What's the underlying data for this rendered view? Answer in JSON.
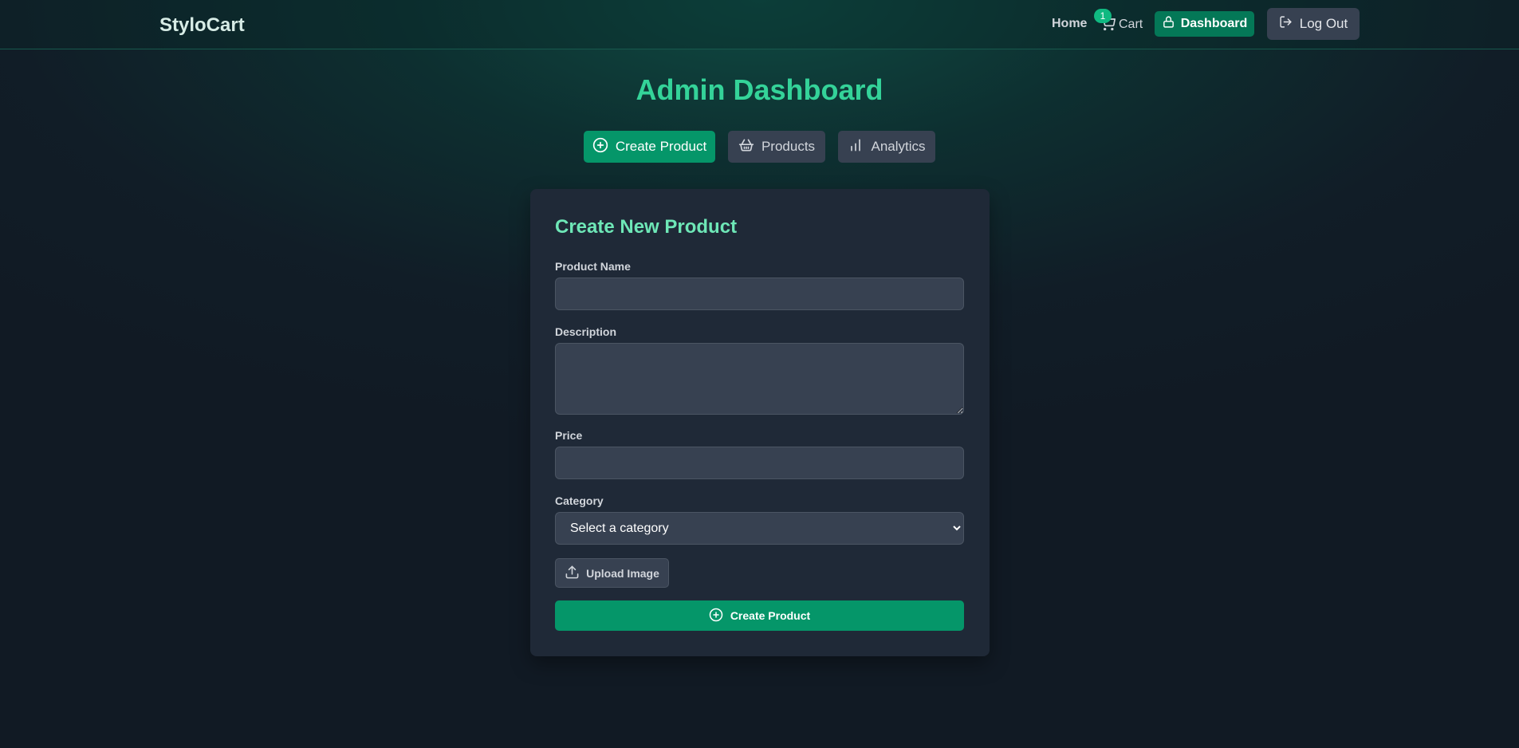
{
  "nav": {
    "brand": "StyloCart",
    "home": "Home",
    "cart": "Cart",
    "cart_count": "1",
    "dashboard": "Dashboard",
    "logout": "Log Out"
  },
  "page": {
    "title": "Admin Dashboard"
  },
  "tabs": [
    {
      "label": "Create Product",
      "icon": "plus-circle-icon",
      "active": true
    },
    {
      "label": "Products",
      "icon": "basket-icon",
      "active": false
    },
    {
      "label": "Analytics",
      "icon": "bar-chart-icon",
      "active": false
    }
  ],
  "form": {
    "title": "Create New Product",
    "name_label": "Product Name",
    "name_value": "",
    "description_label": "Description",
    "description_value": "",
    "price_label": "Price",
    "price_value": "",
    "category_label": "Category",
    "category_selected": "Select a category",
    "upload_label": "Upload Image",
    "submit_label": "Create Product"
  },
  "colors": {
    "accent": "#059669",
    "title": "#34d399",
    "card": "#1f2937",
    "input": "#374151"
  }
}
